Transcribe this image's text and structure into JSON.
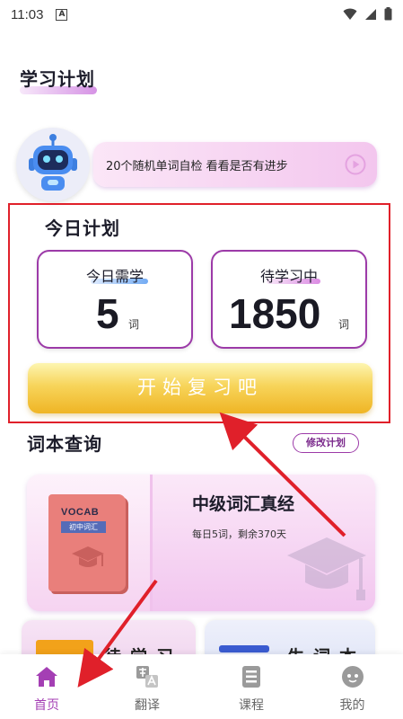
{
  "status_bar": {
    "time": "11:03",
    "notification": "A"
  },
  "page_title": "学习计划",
  "selfcheck": {
    "text": "20个随机单词自检  看看是否有进步"
  },
  "today_plan": {
    "title": "今日计划",
    "need_label": "今日需学",
    "need_value": "5",
    "need_unit": "词",
    "pending_label": "待学习中",
    "pending_value": "1850",
    "pending_unit": "词",
    "review_button": "开始复习吧"
  },
  "wordbook": {
    "section_title": "词本查询",
    "edit_button": "修改计划",
    "cover_title": "VOCAB",
    "cover_tag": "初中词汇",
    "name": "中级词汇真经",
    "progress": "每日5词，剩余370天"
  },
  "mini_cards": [
    {
      "label": "待学习"
    },
    {
      "label": "生词本"
    }
  ],
  "tabs": [
    {
      "label": "首页",
      "icon": "home-icon",
      "active": true
    },
    {
      "label": "翻译",
      "icon": "translate-icon",
      "active": false
    },
    {
      "label": "课程",
      "icon": "course-icon",
      "active": false
    },
    {
      "label": "我的",
      "icon": "profile-icon",
      "active": false
    }
  ],
  "colors": {
    "accent": "#a43fb4",
    "card_border": "#9c3aa8",
    "highlight_box": "#e0202a",
    "button_yellow": "#f7d45a"
  }
}
